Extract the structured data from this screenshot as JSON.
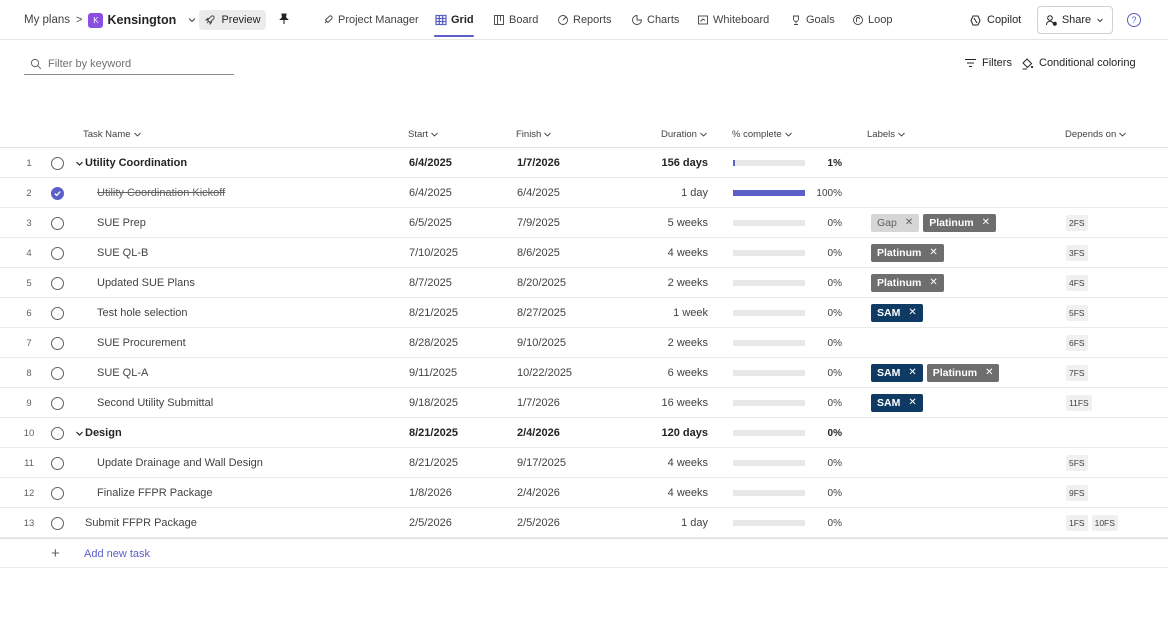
{
  "breadcrumb": {
    "root": "My plans",
    "plan_icon_text": "K",
    "plan_name": "Kensington"
  },
  "preview_label": "Preview",
  "nav": {
    "project_manager": "Project Manager",
    "grid": "Grid",
    "board": "Board",
    "reports": "Reports",
    "charts": "Charts",
    "whiteboard": "Whiteboard",
    "goals": "Goals",
    "loop": "Loop"
  },
  "actions": {
    "copilot": "Copilot",
    "share": "Share",
    "help": "?"
  },
  "toolbar": {
    "filter_placeholder": "Filter by keyword",
    "filters": "Filters",
    "conditional_coloring": "Conditional coloring"
  },
  "columns": {
    "task_name": "Task Name",
    "start": "Start",
    "finish": "Finish",
    "duration": "Duration",
    "pct_complete": "% complete",
    "labels": "Labels",
    "depends_on": "Depends on"
  },
  "tasks": [
    {
      "num": "1",
      "name": "Utility Coordination",
      "start": "6/4/2025",
      "finish": "1/7/2026",
      "duration": "156 days",
      "progress": 0.01,
      "pct": "1%",
      "labels": [],
      "depends": []
    },
    {
      "num": "2",
      "name": "Utility Coordination Kickoff",
      "start": "6/4/2025",
      "finish": "6/4/2025",
      "duration": "1 day",
      "progress": 1.0,
      "pct": "100%",
      "labels": [],
      "depends": []
    },
    {
      "num": "3",
      "name": "SUE Prep",
      "start": "6/5/2025",
      "finish": "7/9/2025",
      "duration": "5 weeks",
      "progress": 0,
      "pct": "0%",
      "labels": [
        {
          "text": "Gap",
          "style": "gray"
        },
        {
          "text": "Platinum",
          "style": "dark"
        }
      ],
      "depends": [
        "2FS"
      ]
    },
    {
      "num": "4",
      "name": "SUE QL-B",
      "start": "7/10/2025",
      "finish": "8/6/2025",
      "duration": "4 weeks",
      "progress": 0,
      "pct": "0%",
      "labels": [
        {
          "text": "Platinum",
          "style": "dark"
        }
      ],
      "depends": [
        "3FS"
      ]
    },
    {
      "num": "5",
      "name": "Updated SUE Plans",
      "start": "8/7/2025",
      "finish": "8/20/2025",
      "duration": "2 weeks",
      "progress": 0,
      "pct": "0%",
      "labels": [
        {
          "text": "Platinum",
          "style": "dark"
        }
      ],
      "depends": [
        "4FS"
      ]
    },
    {
      "num": "6",
      "name": "Test hole selection",
      "start": "8/21/2025",
      "finish": "8/27/2025",
      "duration": "1 week",
      "progress": 0,
      "pct": "0%",
      "labels": [
        {
          "text": "SAM",
          "style": "navy"
        }
      ],
      "depends": [
        "5FS"
      ]
    },
    {
      "num": "7",
      "name": "SUE Procurement",
      "start": "8/28/2025",
      "finish": "9/10/2025",
      "duration": "2 weeks",
      "progress": 0,
      "pct": "0%",
      "labels": [],
      "depends": [
        "6FS"
      ]
    },
    {
      "num": "8",
      "name": "SUE QL-A",
      "start": "9/11/2025",
      "finish": "10/22/2025",
      "duration": "6 weeks",
      "progress": 0,
      "pct": "0%",
      "labels": [
        {
          "text": "SAM",
          "style": "navy"
        },
        {
          "text": "Platinum",
          "style": "dark"
        }
      ],
      "depends": [
        "7FS"
      ]
    },
    {
      "num": "9",
      "name": "Second Utility Submittal",
      "start": "9/18/2025",
      "finish": "1/7/2026",
      "duration": "16 weeks",
      "progress": 0,
      "pct": "0%",
      "labels": [
        {
          "text": "SAM",
          "style": "navy"
        }
      ],
      "depends": [
        "11FS"
      ]
    },
    {
      "num": "10",
      "name": "Design",
      "start": "8/21/2025",
      "finish": "2/4/2026",
      "duration": "120 days",
      "progress": 0,
      "pct": "0%",
      "labels": [],
      "depends": []
    },
    {
      "num": "11",
      "name": "Update Drainage and Wall Design",
      "start": "8/21/2025",
      "finish": "9/17/2025",
      "duration": "4 weeks",
      "progress": 0,
      "pct": "0%",
      "labels": [],
      "depends": [
        "5FS"
      ]
    },
    {
      "num": "12",
      "name": "Finalize FFPR Package",
      "start": "1/8/2026",
      "finish": "2/4/2026",
      "duration": "4 weeks",
      "progress": 0,
      "pct": "0%",
      "labels": [],
      "depends": [
        "9FS"
      ]
    },
    {
      "num": "13",
      "name": "Submit FFPR Package",
      "start": "2/5/2026",
      "finish": "2/5/2026",
      "duration": "1 day",
      "progress": 0,
      "pct": "0%",
      "labels": [],
      "depends": [
        "1FS",
        "10FS"
      ]
    }
  ],
  "add_task_label": "Add new task",
  "colors": {
    "accent": "#5b5fc7",
    "label_gray": "#d6d6d6",
    "label_dark": "#6e6e6e",
    "label_navy": "#0e3a64"
  }
}
